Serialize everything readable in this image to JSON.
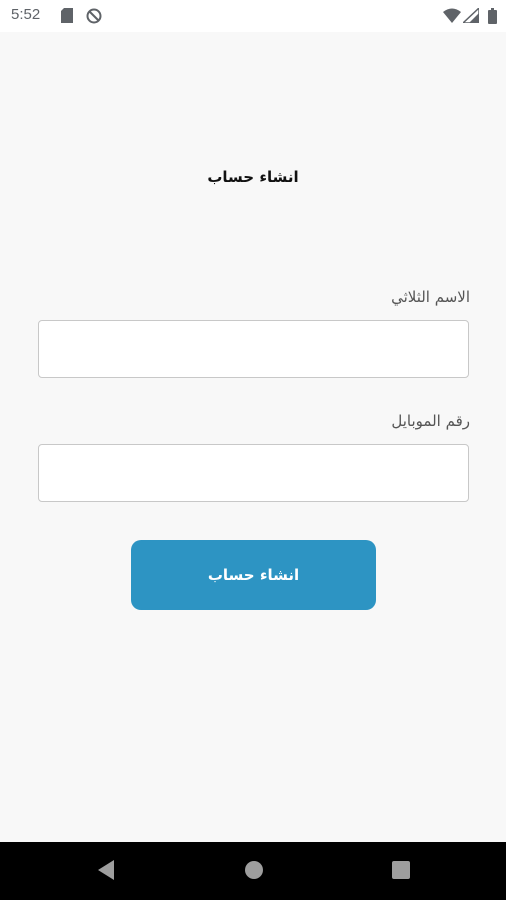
{
  "status_bar": {
    "time": "5:52",
    "icons": [
      "sim-card-icon",
      "do-not-disturb-icon",
      "wifi-icon",
      "cell-signal-icon",
      "battery-icon"
    ]
  },
  "screen": {
    "title": "انشاء حساب"
  },
  "form": {
    "name_label": "الاسم الثلاثي",
    "name_value": "",
    "mobile_label": "رقم الموبايل",
    "mobile_value": "",
    "submit_label": "انشاء حساب"
  },
  "nav_bar": {
    "icons": [
      "back-icon",
      "home-icon",
      "recents-icon"
    ]
  },
  "colors": {
    "accent": "#2d94c3",
    "background": "#f8f8f8",
    "field_border": "#c8c8c8",
    "nav_background": "#000000"
  }
}
